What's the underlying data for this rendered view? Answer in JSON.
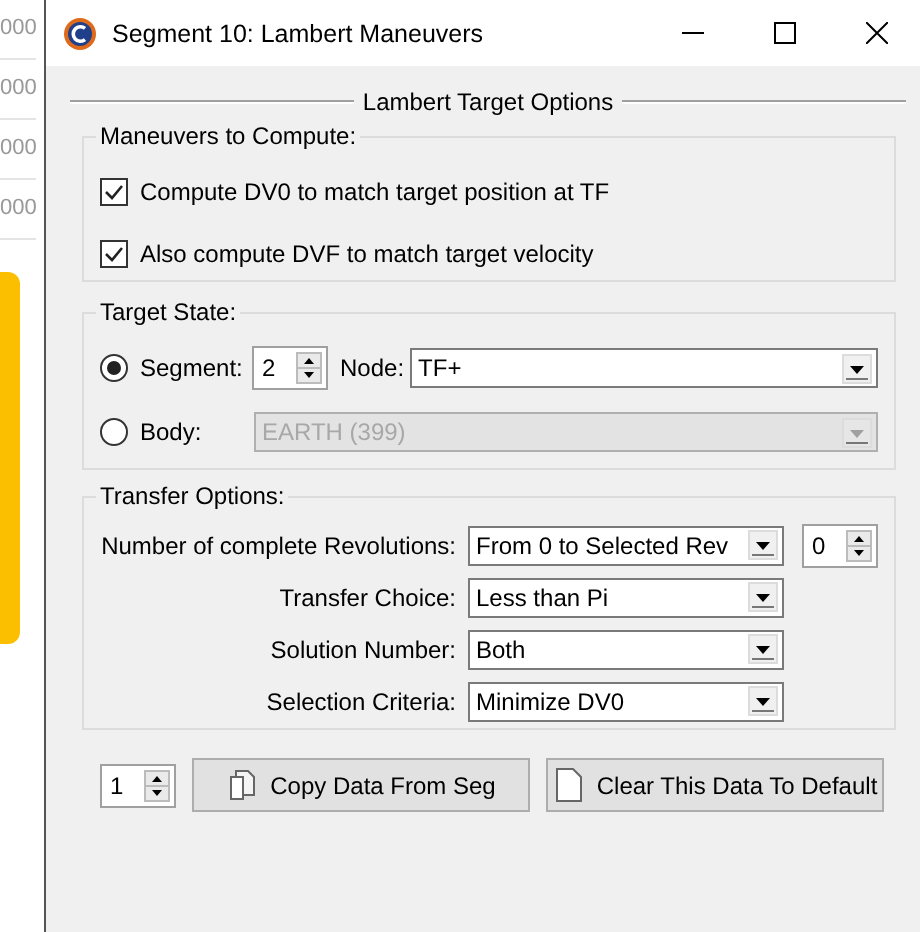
{
  "background": {
    "cells": [
      "000",
      "000",
      "000",
      "000"
    ]
  },
  "window": {
    "title": "Segment 10: Lambert Maneuvers"
  },
  "section_title": "Lambert Target Options",
  "maneuvers": {
    "title": "Maneuvers to Compute:",
    "options": [
      {
        "label": "Compute DV0 to match target position at TF",
        "checked": true
      },
      {
        "label": "Also compute DVF to match target velocity",
        "checked": true
      }
    ]
  },
  "target_state": {
    "title": "Target State:",
    "options": [
      {
        "kind": "segment",
        "label": "Segment:",
        "selected": true,
        "spin_value": "2",
        "node_label": "Node:",
        "value": "TF+",
        "disabled": false
      },
      {
        "kind": "body",
        "label": "Body:",
        "selected": false,
        "value": "EARTH (399)",
        "disabled": true
      }
    ]
  },
  "transfer_options": {
    "title": "Transfer Options:",
    "rows": [
      {
        "label": "Number of complete Revolutions:",
        "value": "From 0 to Selected Rev",
        "spin_value": "0"
      },
      {
        "label": "Transfer Choice:",
        "value": "Less than Pi"
      },
      {
        "label": "Solution Number:",
        "value": "Both"
      },
      {
        "label": "Selection Criteria:",
        "value": "Minimize DV0"
      }
    ]
  },
  "footer": {
    "spin_value": "1",
    "buttons": [
      {
        "label": "Copy Data From Seg"
      },
      {
        "label": "Clear This Data To Default"
      }
    ]
  }
}
